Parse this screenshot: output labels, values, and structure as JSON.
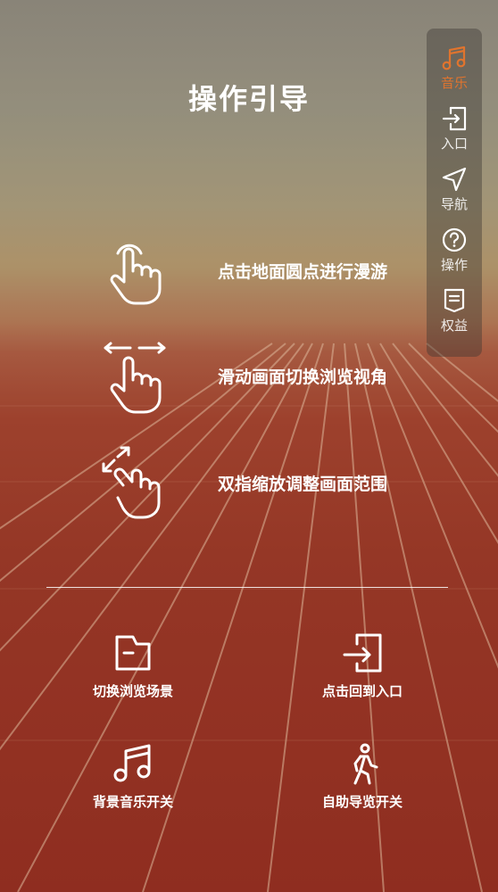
{
  "title": "操作引导",
  "guides": [
    {
      "icon": "tap-hand-icon",
      "text": "点击地面圆点进行漫游"
    },
    {
      "icon": "swipe-hand-icon",
      "text": "滑动画面切换浏览视角"
    },
    {
      "icon": "pinch-zoom-hand-icon",
      "text": "双指缩放调整画面范围"
    }
  ],
  "actions": [
    {
      "icon": "folder-icon",
      "label": "切换浏览场景"
    },
    {
      "icon": "enter-icon",
      "label": "点击回到入口"
    },
    {
      "icon": "music-note-icon",
      "label": "背景音乐开关"
    },
    {
      "icon": "walking-person-icon",
      "label": "自助导览开关"
    }
  ],
  "sidebar": {
    "items": [
      {
        "icon": "music-note-icon",
        "label": "音乐",
        "active": true
      },
      {
        "icon": "enter-icon",
        "label": "入口",
        "active": false
      },
      {
        "icon": "navigation-arrow-icon",
        "label": "导航",
        "active": false
      },
      {
        "icon": "question-icon",
        "label": "操作",
        "active": false
      },
      {
        "icon": "bookmark-icon",
        "label": "权益",
        "active": false
      }
    ]
  },
  "colors": {
    "active": "#e0742e",
    "track_red": "#a4442f",
    "sky": "#9a9482"
  }
}
